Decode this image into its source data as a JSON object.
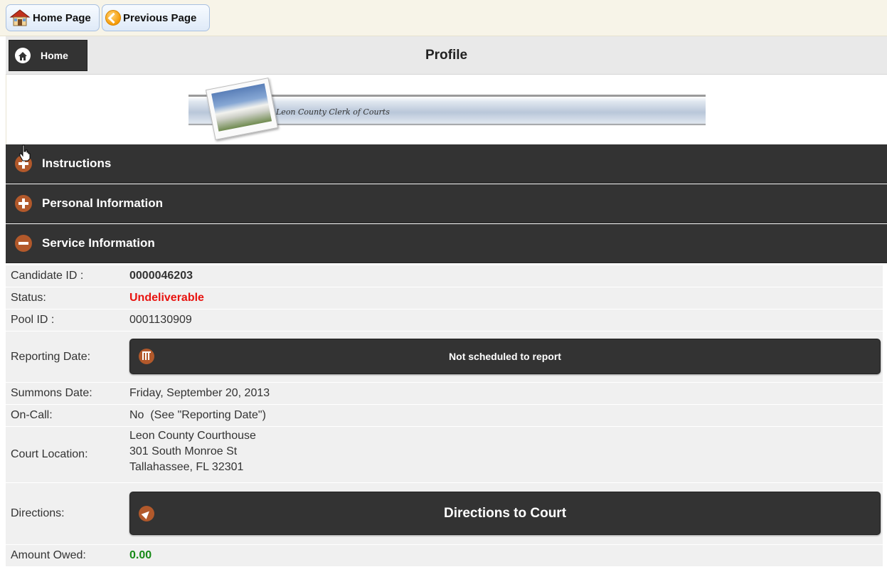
{
  "toolbar": {
    "home_page_label": "Home Page",
    "previous_page_label": "Previous Page"
  },
  "header": {
    "home_label": "Home",
    "title": "Profile"
  },
  "banner": {
    "text": "Leon County Clerk of Courts"
  },
  "sections": {
    "instructions": "Instructions",
    "personal": "Personal Information",
    "service": "Service Information"
  },
  "service": {
    "candidate_id_label": "Candidate ID :",
    "candidate_id": "0000046203",
    "status_label": "Status:",
    "status": "Undeliverable",
    "pool_id_label": "Pool ID :",
    "pool_id": "0001130909",
    "reporting_date_label": "Reporting Date:",
    "reporting_date_button": "Not scheduled to report",
    "summons_date_label": "Summons Date:",
    "summons_date": "Friday, September 20, 2013",
    "on_call_label": "On-Call:",
    "on_call": "No  (See \"Reporting Date\")",
    "court_location_label": "Court Location:",
    "court_location_line1": "Leon County Courthouse",
    "court_location_line2": "301 South Monroe St",
    "court_location_line3": "Tallahassee, FL 32301",
    "directions_label": "Directions:",
    "directions_button": "Directions to Court",
    "amount_owed_label": "Amount Owed:",
    "amount_owed": "0.00"
  },
  "colors": {
    "bar_dark": "#333333",
    "icon_accent": "#b2592b",
    "status_red": "#e8130f",
    "amount_green": "#178a17"
  }
}
